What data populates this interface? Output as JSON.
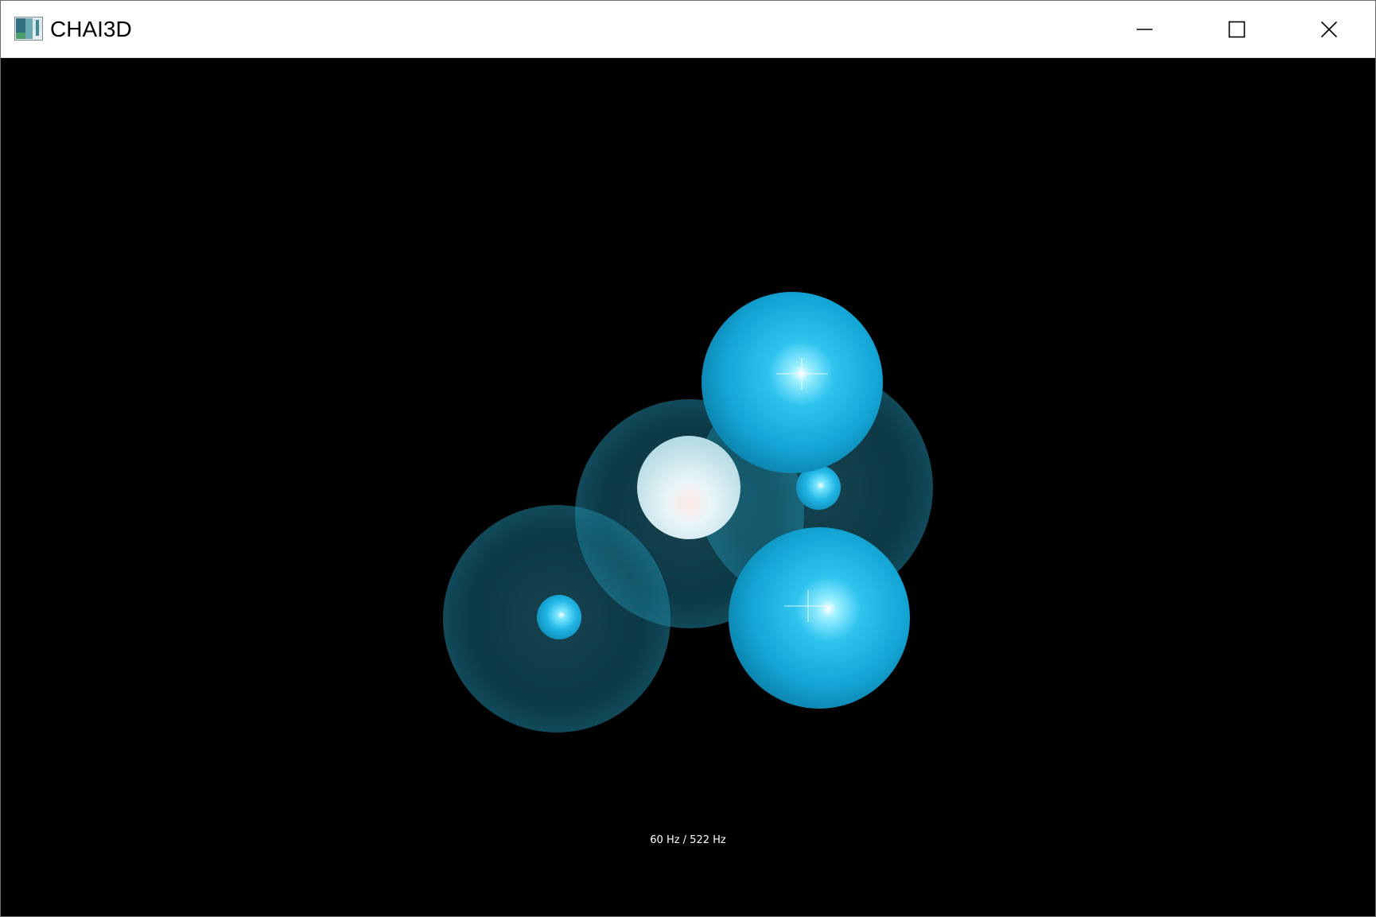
{
  "window": {
    "title": "CHAI3D",
    "app_icon": "chai3d-app-icon",
    "controls": {
      "minimize_icon": "minimize-icon",
      "maximize_icon": "maximize-icon",
      "close_icon": "close-icon"
    }
  },
  "scene": {
    "background_color": "#000000",
    "sphere_color": "#1ab3e6",
    "cursor_color": "#e6f4f7",
    "spheres": [
      {
        "name": "left-transparent-sphere",
        "style": "transparent"
      },
      {
        "name": "center-transparent-sphere",
        "style": "transparent"
      },
      {
        "name": "right-transparent-sphere",
        "style": "transparent"
      },
      {
        "name": "top-solid-sphere",
        "style": "solid"
      },
      {
        "name": "bottom-solid-sphere",
        "style": "solid"
      }
    ]
  },
  "status": {
    "rates": "60 Hz / 522 Hz"
  }
}
